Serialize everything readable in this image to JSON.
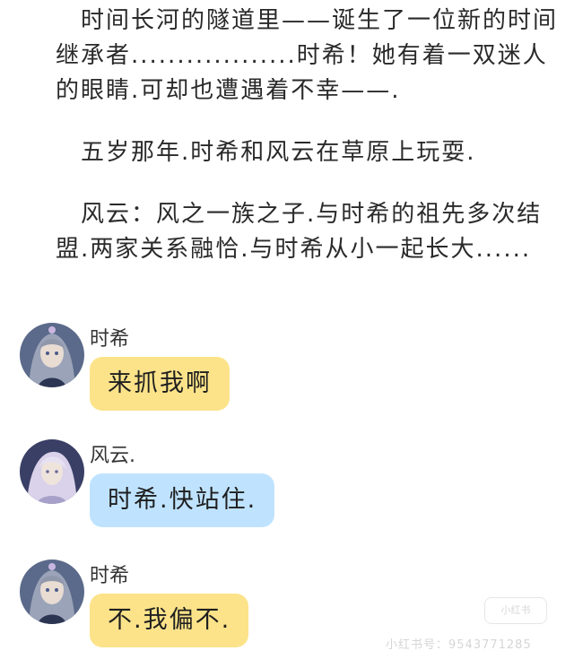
{
  "story": {
    "paragraphs": [
      "时间长河的隧道里——诞生了一位新的时间继承者..................时希！她有着一双迷人的眼睛.可却也遭遇着不幸——.",
      "五岁那年.时希和风云在草原上玩耍.",
      "风云：风之一族之子.与时希的祖先多次结盟.两家关系融恰.与时希从小一起长大......"
    ]
  },
  "chat": [
    {
      "sender": "时希",
      "text": "来抓我啊",
      "bubble_color": "#fce38a",
      "avatar": "shixi-avatar"
    },
    {
      "sender": "风云.",
      "text": "时希.快站住.",
      "bubble_color": "#bfe3ff",
      "avatar": "fengyun-avatar"
    },
    {
      "sender": "时希",
      "text": "不.我偏不.",
      "bubble_color": "#fce38a",
      "avatar": "shixi-avatar"
    }
  ],
  "watermark": {
    "logo": "小红书",
    "id_text": "小红书号：9543771285"
  }
}
